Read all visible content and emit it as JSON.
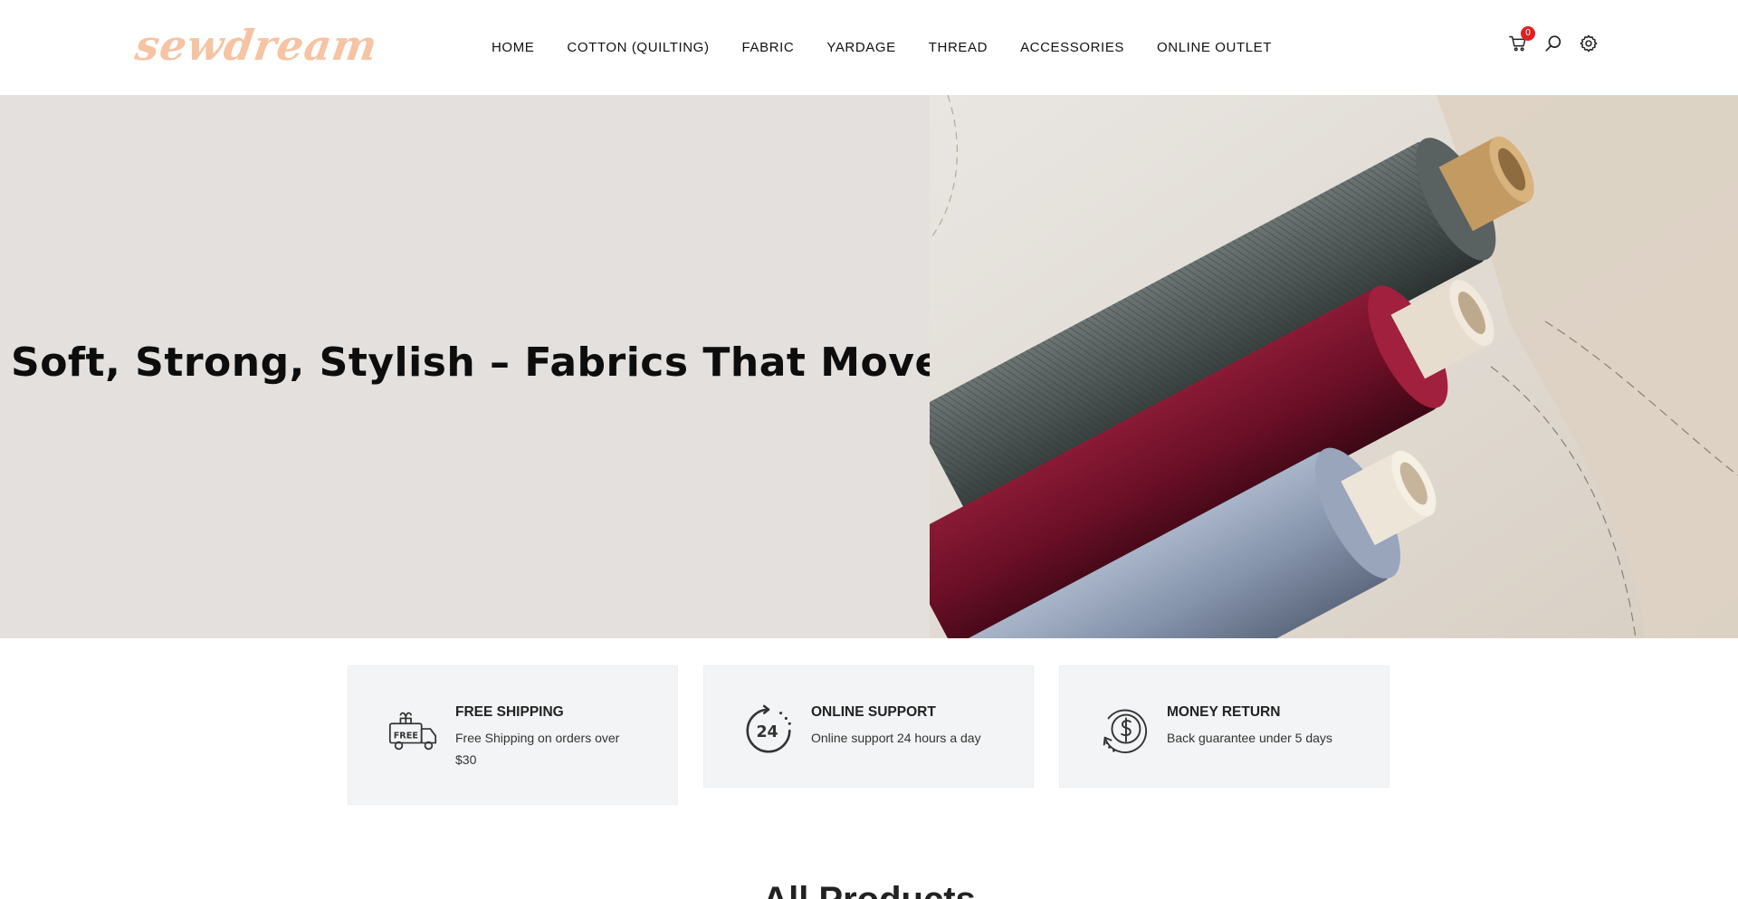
{
  "header": {
    "logo_text": "sewdream",
    "nav": [
      {
        "label": "HOME"
      },
      {
        "label": "COTTON (QUILTING)"
      },
      {
        "label": "FABRIC"
      },
      {
        "label": "YARDAGE"
      },
      {
        "label": "THREAD"
      },
      {
        "label": "ACCESSORIES"
      },
      {
        "label": "ONLINE OUTLET"
      }
    ],
    "cart_count": "0",
    "icons": {
      "cart": "cart-icon",
      "search": "search-icon",
      "settings": "gear-icon"
    }
  },
  "hero": {
    "title": "Soft, Strong, Stylish – Fabrics That Move With You",
    "image": "fabric-rolls-image"
  },
  "features": [
    {
      "title": "FREE SHIPPING",
      "desc": "Free Shipping on orders over $30",
      "icon": "free-delivery-truck-icon"
    },
    {
      "title": "ONLINE SUPPORT",
      "desc": "Online support 24 hours a day",
      "icon": "24-hour-support-icon"
    },
    {
      "title": "MONEY RETURN",
      "desc": "Back guarantee under 5 days",
      "icon": "money-return-icon"
    }
  ],
  "section": {
    "title": "All Products"
  },
  "colors": {
    "logo": "#f6c3a3",
    "hero_bg": "#e3e0dd",
    "feature_bg": "#f3f4f5",
    "badge": "#e02020"
  }
}
